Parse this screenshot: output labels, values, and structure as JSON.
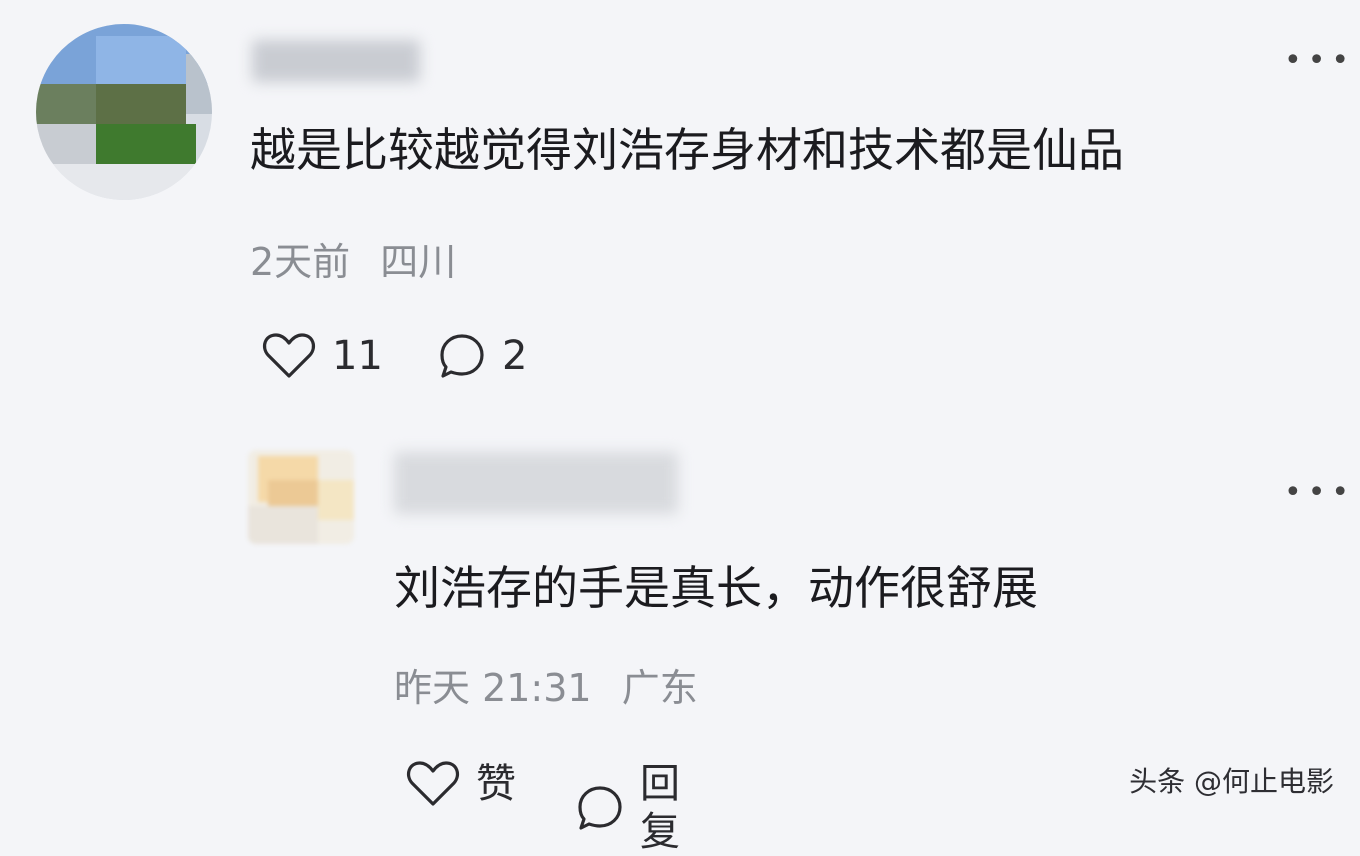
{
  "comment": {
    "body": "越是比较越觉得刘浩存身材和技术都是仙品",
    "time": "2天前",
    "location": "四川",
    "like_count": "11",
    "reply_count": "2",
    "more_icon": "more-horizontal-icon"
  },
  "reply": {
    "body": "刘浩存的手是真长，动作很舒展",
    "time": "昨天 21:31",
    "location": "广东",
    "like_label": "赞",
    "reply_label": "回复",
    "more_icon": "more-horizontal-icon"
  },
  "watermark": "头条 @何止电影",
  "colors": {
    "background": "#f4f5f8",
    "text": "#1b1b1f",
    "meta": "#8a8d93"
  }
}
